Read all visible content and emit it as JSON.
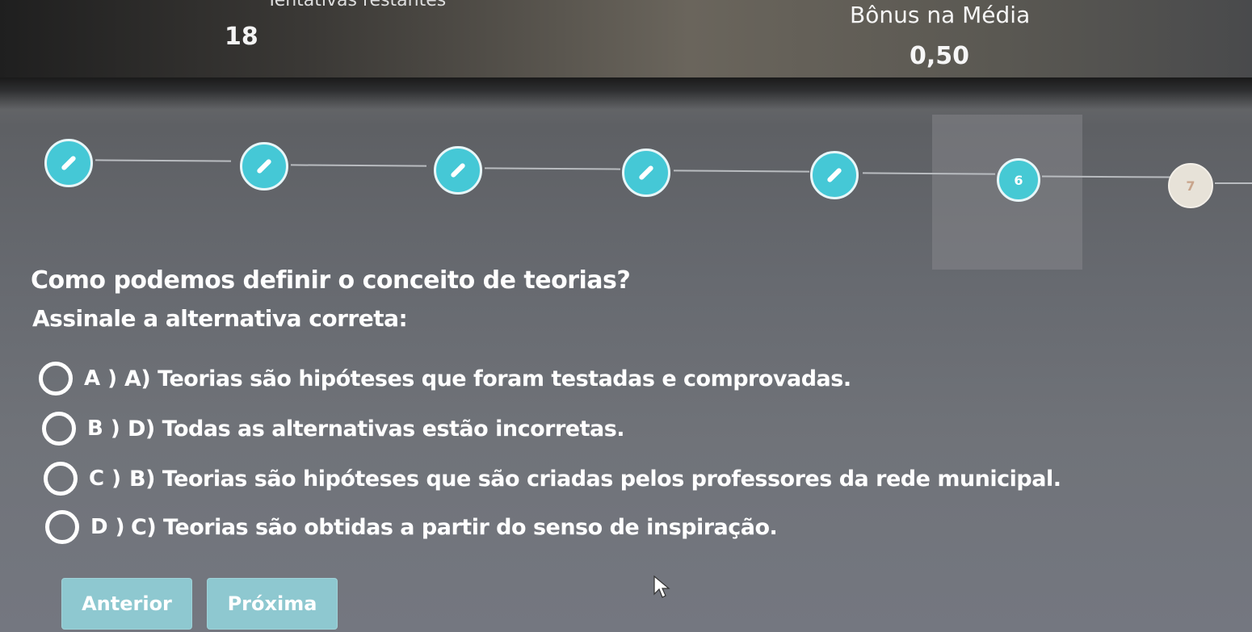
{
  "header": {
    "left_label_cut": "Tentativas restantes",
    "left_value": "18",
    "bonus_label": "Bônus na Média",
    "bonus_value": "0,50"
  },
  "stepper": {
    "steps": [
      {
        "label": "",
        "state": "done",
        "icon": "pencil-icon"
      },
      {
        "label": "",
        "state": "done",
        "icon": "pencil-icon"
      },
      {
        "label": "",
        "state": "done",
        "icon": "pencil-icon"
      },
      {
        "label": "",
        "state": "done",
        "icon": "pencil-icon"
      },
      {
        "label": "",
        "state": "done",
        "icon": "pencil-icon"
      },
      {
        "label": "6",
        "state": "current"
      },
      {
        "label": "7",
        "state": "todo"
      }
    ],
    "active_color": "#45c8d6",
    "todo_color": "#e7e2d8"
  },
  "question": {
    "text": "Como podemos definir o conceito de teorias?",
    "instruction": "Assinale  a alternativa correta:"
  },
  "options": [
    {
      "letter": "A )",
      "text": "A) Teorias são hipóteses que foram testadas e comprovadas."
    },
    {
      "letter": "B )",
      "text": "D) Todas as alternativas estão incorretas."
    },
    {
      "letter": "C )",
      "text": "B) Teorias são hipóteses que são criadas pelos professores da rede municipal."
    },
    {
      "letter": "D )",
      "text": "C) Teorias são obtidas a partir do senso de inspiração."
    }
  ],
  "navigation": {
    "previous_label": "Anterior",
    "next_label": "Próxima",
    "button_color": "#8ec8d0"
  }
}
